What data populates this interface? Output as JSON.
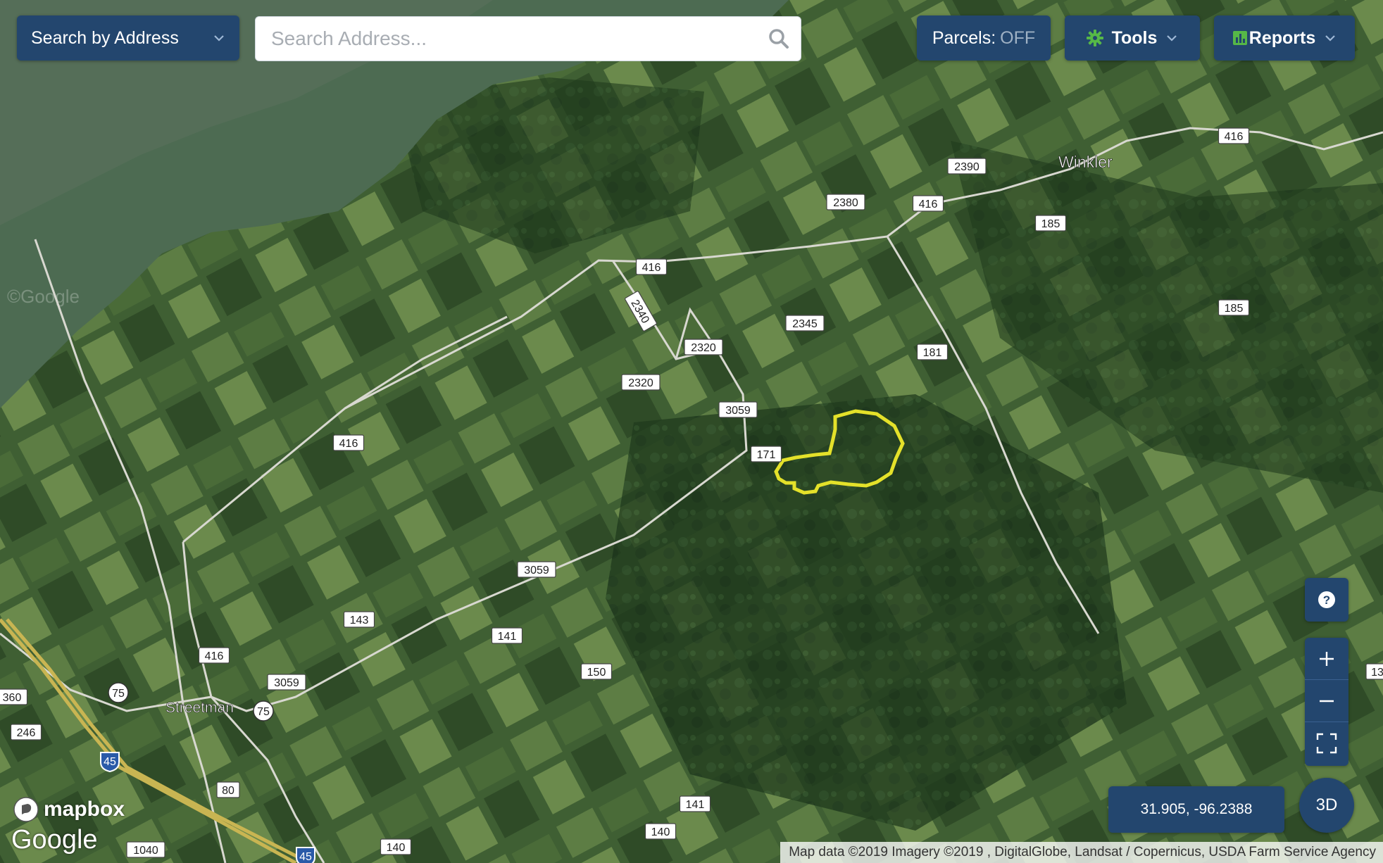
{
  "search": {
    "mode_label": "Search by Address",
    "placeholder": "Search Address..."
  },
  "toolbar": {
    "parcels_label": "Parcels:",
    "parcels_state": "OFF",
    "tools_label": "Tools",
    "reports_label": "Reports"
  },
  "map": {
    "place_labels": [
      "Winkler",
      "Streetman"
    ],
    "road_labels": [
      "416",
      "416",
      "416",
      "416",
      "416",
      "2390",
      "2380",
      "185",
      "185",
      "2340",
      "2320",
      "2320",
      "2345",
      "181",
      "3059",
      "3059",
      "3059",
      "171",
      "143",
      "141",
      "141",
      "150",
      "140",
      "140",
      "75",
      "75",
      "45",
      "45",
      "80",
      "246",
      "360",
      "1040",
      "13"
    ],
    "watermark": "©Google",
    "parcel_outline_color": "#e4e12a"
  },
  "controls": {
    "help_icon": "question-icon",
    "zoom_in_icon": "plus-icon",
    "zoom_out_icon": "minus-icon",
    "fullscreen_icon": "fullscreen-icon",
    "coordinates": "31.905, -96.2388",
    "view_3d_label": "3D"
  },
  "branding": {
    "mapbox": "mapbox",
    "google": "Google"
  },
  "attribution": "Map data ©2019 Imagery ©2019 , DigitalGlobe, Landsat / Copernicus, USDA Farm Service Agency",
  "colors": {
    "control_bg": "#23466e",
    "accent_green": "#56b847",
    "parcels_off": "#9fb1c4"
  }
}
